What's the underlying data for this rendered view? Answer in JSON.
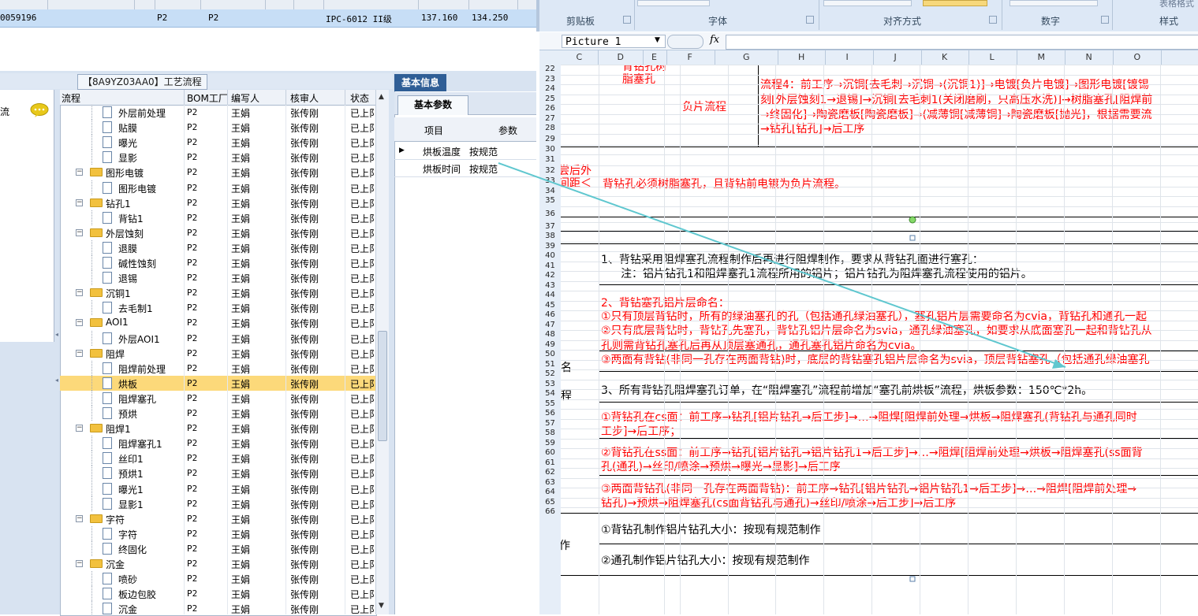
{
  "top_row": {
    "id": "0059196",
    "c1": "P2",
    "c2": "P2",
    "spec": "IPC-6012 II级",
    "v1": "137.160",
    "v2": "134.250"
  },
  "tree_title": "【8A9YZ03AA0】工艺流程",
  "side_label": "流",
  "tree_columns": {
    "flow": "流程",
    "bom": "BOM工厂",
    "writer": "编写人",
    "reviewer": "核审人",
    "status": "状态"
  },
  "tree_rows": [
    {
      "label": "外层前处理",
      "bom": "P2",
      "writer": "王娟",
      "reviewer": "张传刚",
      "status": "已上阝"
    },
    {
      "label": "贴膜",
      "bom": "P2",
      "writer": "王娟",
      "reviewer": "张传刚",
      "status": "已上阝"
    },
    {
      "label": "曝光",
      "bom": "P2",
      "writer": "王娟",
      "reviewer": "张传刚",
      "status": "已上阝"
    },
    {
      "label": "显影",
      "bom": "P2",
      "writer": "王娟",
      "reviewer": "张传刚",
      "status": "已上阝"
    },
    {
      "label": "图形电镀",
      "bom": "P2",
      "writer": "王娟",
      "reviewer": "张传刚",
      "status": "已上阝"
    },
    {
      "label": "图形电镀",
      "bom": "P2",
      "writer": "王娟",
      "reviewer": "张传刚",
      "status": "已上阝"
    },
    {
      "label": "钻孔1",
      "bom": "P2",
      "writer": "王娟",
      "reviewer": "张传刚",
      "status": "已上阝"
    },
    {
      "label": "背钻1",
      "bom": "P2",
      "writer": "王娟",
      "reviewer": "张传刚",
      "status": "已上阝"
    },
    {
      "label": "外层蚀刻",
      "bom": "P2",
      "writer": "王娟",
      "reviewer": "张传刚",
      "status": "已上阝"
    },
    {
      "label": "退膜",
      "bom": "P2",
      "writer": "王娟",
      "reviewer": "张传刚",
      "status": "已上阝"
    },
    {
      "label": "碱性蚀刻",
      "bom": "P2",
      "writer": "王娟",
      "reviewer": "张传刚",
      "status": "已上阝"
    },
    {
      "label": "退锡",
      "bom": "P2",
      "writer": "王娟",
      "reviewer": "张传刚",
      "status": "已上阝"
    },
    {
      "label": "沉铜1",
      "bom": "P2",
      "writer": "王娟",
      "reviewer": "张传刚",
      "status": "已上阝"
    },
    {
      "label": "去毛制1",
      "bom": "P2",
      "writer": "王娟",
      "reviewer": "张传刚",
      "status": "已上阝"
    },
    {
      "label": "AOI1",
      "bom": "P2",
      "writer": "王娟",
      "reviewer": "张传刚",
      "status": "已上阝"
    },
    {
      "label": "外层AOI1",
      "bom": "P2",
      "writer": "王娟",
      "reviewer": "张传刚",
      "status": "已上阝"
    },
    {
      "label": "阻焊",
      "bom": "P2",
      "writer": "王娟",
      "reviewer": "张传刚",
      "status": "已上阝"
    },
    {
      "label": "阻焊前处理",
      "bom": "P2",
      "writer": "王娟",
      "reviewer": "张传刚",
      "status": "已上阝"
    },
    {
      "label": "烘板",
      "bom": "P2",
      "writer": "王娟",
      "reviewer": "张传刚",
      "status": "已上阝"
    },
    {
      "label": "阻焊塞孔",
      "bom": "P2",
      "writer": "王娟",
      "reviewer": "张传刚",
      "status": "已上阝"
    },
    {
      "label": "预烘",
      "bom": "P2",
      "writer": "王娟",
      "reviewer": "张传刚",
      "status": "已上阝"
    },
    {
      "label": "阻焊1",
      "bom": "P2",
      "writer": "王娟",
      "reviewer": "张传刚",
      "status": "已上阝"
    },
    {
      "label": "阻焊塞孔1",
      "bom": "P2",
      "writer": "王娟",
      "reviewer": "张传刚",
      "status": "已上阝"
    },
    {
      "label": "丝印1",
      "bom": "P2",
      "writer": "王娟",
      "reviewer": "张传刚",
      "status": "已上阝"
    },
    {
      "label": "预烘1",
      "bom": "P2",
      "writer": "王娟",
      "reviewer": "张传刚",
      "status": "已上阝"
    },
    {
      "label": "曝光1",
      "bom": "P2",
      "writer": "王娟",
      "reviewer": "张传刚",
      "status": "已上阝"
    },
    {
      "label": "显影1",
      "bom": "P2",
      "writer": "王娟",
      "reviewer": "张传刚",
      "status": "已上阝"
    },
    {
      "label": "字符",
      "bom": "P2",
      "writer": "王娟",
      "reviewer": "张传刚",
      "status": "已上阝"
    },
    {
      "label": "字符",
      "bom": "P2",
      "writer": "王娟",
      "reviewer": "张传刚",
      "status": "已上阝"
    },
    {
      "label": "终固化",
      "bom": "P2",
      "writer": "王娟",
      "reviewer": "张传刚",
      "status": "已上阝"
    },
    {
      "label": "沉金",
      "bom": "P2",
      "writer": "王娟",
      "reviewer": "张传刚",
      "status": "已上阝"
    },
    {
      "label": "喷砂",
      "bom": "P2",
      "writer": "王娟",
      "reviewer": "张传刚",
      "status": "已上阝"
    },
    {
      "label": "板边包胶",
      "bom": "P2",
      "writer": "王娟",
      "reviewer": "张传刚",
      "status": "已上阝"
    },
    {
      "label": "沉金",
      "bom": "P2",
      "writer": "王娟",
      "reviewer": "张传刚",
      "status": "已上阝"
    }
  ],
  "info_tab": "基本信息",
  "param_tab": "基本参数",
  "param_columns": {
    "item": "项目",
    "param": "参数"
  },
  "param_rows": [
    {
      "item": "烘板温度",
      "param": "按规范"
    },
    {
      "item": "烘板时间",
      "param": "按规范"
    }
  ],
  "ribbon": {
    "clipboard": "剪贴板",
    "font": "字体",
    "align": "对齐方式",
    "number": "数字",
    "style": "样式",
    "table_style": "表格格式"
  },
  "name_box": "Picture 1",
  "fx_label": "fx",
  "columns": [
    "C",
    "D",
    "E",
    "F",
    "G",
    "H",
    "I",
    "J",
    "K",
    "L",
    "M",
    "N",
    "O"
  ],
  "row_numbers": [
    "22",
    "23",
    "24",
    "25",
    "26",
    "27",
    "28",
    "29",
    "30",
    "31",
    "32",
    "33",
    "34",
    "35",
    "36",
    "37",
    "38",
    "39",
    "40",
    "41",
    "42",
    "43",
    "44",
    "45",
    "46",
    "47",
    "48",
    "49",
    "50",
    "51",
    "52",
    "53",
    "54",
    "55",
    "56",
    "57",
    "58",
    "59",
    "60",
    "61",
    "62",
    "63",
    "64",
    "65",
    "66"
  ],
  "sheet": {
    "d_top": "背钻孔树脂塞孔",
    "d_top_a": "背钻孔树",
    "d_top_b": "脂塞孔",
    "f_label": "负片流程",
    "flow4_1": "流程4：前工序→沉铜[去毛刺→沉铜→(沉铜1)]→电镀[负片电镀]→图形电镀[镀锡",
    "flow4_2": "刻[外层蚀刻1→退锡]→沉铜[去毛刺1(关闭磨刷，只高压水洗)]→树脂塞孔[阻焊前",
    "flow4_3": "→终固化]→陶瓷磨板[陶瓷磨板]→(减薄铜[减薄铜]→陶瓷磨板[抛光]，根据需要流",
    "flow4_4": "→钻孔[钻孔]→后工序",
    "c_cut_1": "尝后外",
    "c_cut_2": "间距＜",
    "must_resin": "背钻孔必须树脂塞孔，且背钻前电镀为负片流程。",
    "note1_1": "1、背钻采用阻焊塞孔流程制作后再进行阻焊制作，要求从背钻孔面进行塞孔：",
    "note1_2": "注：铝片钻孔1和阻焊塞孔1流程所用的铝片；铝片钻孔为阻焊塞孔流程使用的铝片。",
    "note2_1": "2、背钻塞孔铝片层命名：",
    "note2_2": "①只有顶层背钻时，所有的绿油塞孔的孔（包括通孔绿油塞孔），塞孔铝片层需要命名为cvia，背钻孔和通孔一起",
    "note2_3": "②只有底层背钻时，背钻孔先塞孔，背钻孔铝片层命名为svia，通孔绿油塞孔，如要求从底面塞孔一起和背钻孔从",
    "note2_4": "孔则需背钻孔塞孔后再从顶层塞通孔，通孔塞孔铝片命名为cvia。",
    "note2_5": "③两面有背钻(非同一孔存在两面背钻)时，底层的背钻塞孔铝片层命名为svia，顶层背钻塞孔（包括通孔绿油塞孔",
    "c_ming": "名",
    "c_cheng": "程",
    "note3": "3、所有背钻孔阻焊塞孔订单，在“阻焊塞孔”流程前增加“塞孔前烘板”流程，烘板参数：150℃*2h。",
    "cs1_1": "①背钻孔在cs面：前工序→钻孔[铝片钻孔→后工步]→…→阻焊[阻焊前处理→烘板→阻焊塞孔(背钻孔与通孔同时",
    "cs1_2": "工步]→后工序；",
    "ss2_1": "②背钻孔在ss面：前工序→钻孔[铝片钻孔→铝片钻孔1→后工步]→…→阻焊[阻焊前处理→烘板→阻焊塞孔(ss面背",
    "ss2_2": "孔(通孔)→丝印/喷涂→预烘→曝光→显影]→后工序",
    "both3_1": "③两面背钻孔(非同一孔存在两面背钻)：前工序→钻孔[铝片钻孔→铝片钻孔1→后工步]→…→阻焊[阻焊前处理→",
    "both3_2": "钻孔)→预烘→阻焊塞孔(cs面背钻孔与通孔)→丝印/喷涂→后工步]→后工序",
    "size1": "①背钻孔制作铝片钻孔大小：按现有规范制作",
    "size2": "②通孔制作铝片钻孔大小：按现有规范制作",
    "c_zuo": "作"
  }
}
